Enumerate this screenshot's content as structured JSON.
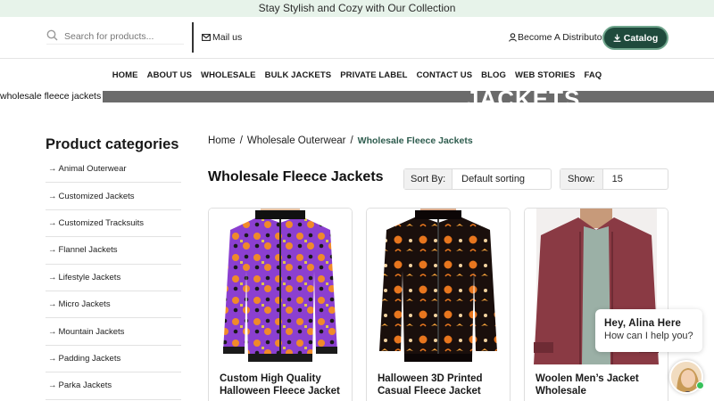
{
  "topbar": {
    "text": "Stay Stylish and Cozy with Our Collection"
  },
  "header": {
    "search_placeholder": "Search for products...",
    "mail_label": "Mail us",
    "distributor_label": "Become A Distributor",
    "catalog_label": "Catalog"
  },
  "nav": {
    "items": [
      "HOME",
      "ABOUT US",
      "WHOLESALE",
      "BULK JACKETS",
      "PRIVATE LABEL",
      "CONTACT US",
      "BLOG",
      "WEB STORIES",
      "FAQ"
    ]
  },
  "banner": {
    "alt_text": "wholesale fleece jackets",
    "overlay_text": "JACKETS"
  },
  "sidebar": {
    "title": "Product categories",
    "items": [
      "Animal Outerwear",
      "Customized Jackets",
      "Customized Tracksuits",
      "Flannel Jackets",
      "Lifestyle Jackets",
      "Micro Jackets",
      "Mountain Jackets",
      "Padding Jackets",
      "Parka Jackets"
    ]
  },
  "breadcrumb": {
    "home": "Home",
    "sep": "/",
    "parent": "Wholesale Outerwear",
    "current": "Wholesale Fleece Jackets"
  },
  "listing": {
    "title": "Wholesale Fleece Jackets",
    "sort_label": "Sort By:",
    "sort_value": "Default sorting",
    "show_label": "Show:",
    "show_value": "15"
  },
  "products": [
    {
      "name": "Custom High Quality Halloween Fleece Jacket"
    },
    {
      "name": "Halloween 3D Printed Casual Fleece Jacket"
    },
    {
      "name": "Woolen Men’s Jacket Wholesale"
    }
  ],
  "chat": {
    "greeting": "Hey, Alina Here",
    "message": "How can I help you?"
  },
  "colors": {
    "accent_green": "#1f4a3c",
    "topbar_bg": "#e7f3ea",
    "breadcrumb_current": "#2e5c4e"
  }
}
